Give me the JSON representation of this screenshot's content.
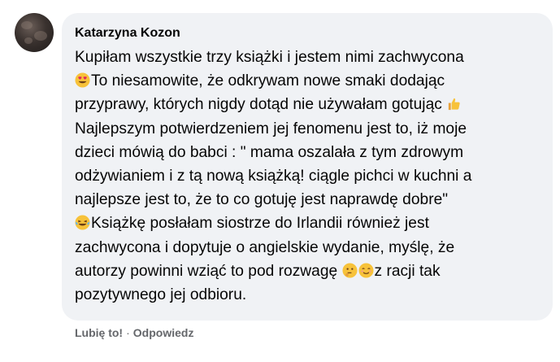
{
  "comment": {
    "author": "Katarzyna Kozon",
    "lines": {
      "l1": "Kupiłam wszystkie trzy książki i jestem nimi zachwycona",
      "l2": "To niesamowite, że odkrywam nowe smaki dodając",
      "l3": "przyprawy, których nigdy dotąd nie używałam gotując",
      "l4": "Najlepszym potwierdzeniem jej fenomenu jest to, iż moje",
      "l5": "dzieci mówią do babci : \" mama oszalała z tym zdrowym",
      "l6": "odżywianiem i z tą nową książką! ciągle pichci w kuchni a",
      "l7": "najlepsze jest to, że to co gotuję jest naprawdę dobre\"",
      "l8": "Książkę posłałam siostrze do Irlandii również jest",
      "l9": "zachwycona i dopytuje o angielskie wydanie, myślę, że",
      "l10": "autorzy powinni wziąć to pod rozwagę",
      "l10b": "z racji tak",
      "l11": "pozytywnego jej odbioru."
    },
    "emojis": [
      "heart-eyes",
      "thumbs-up",
      "tears-of-joy",
      "thinking-face",
      "smiling-face"
    ]
  },
  "actions": {
    "like": "Lubię to!",
    "separator": "·",
    "reply": "Odpowiedz"
  }
}
